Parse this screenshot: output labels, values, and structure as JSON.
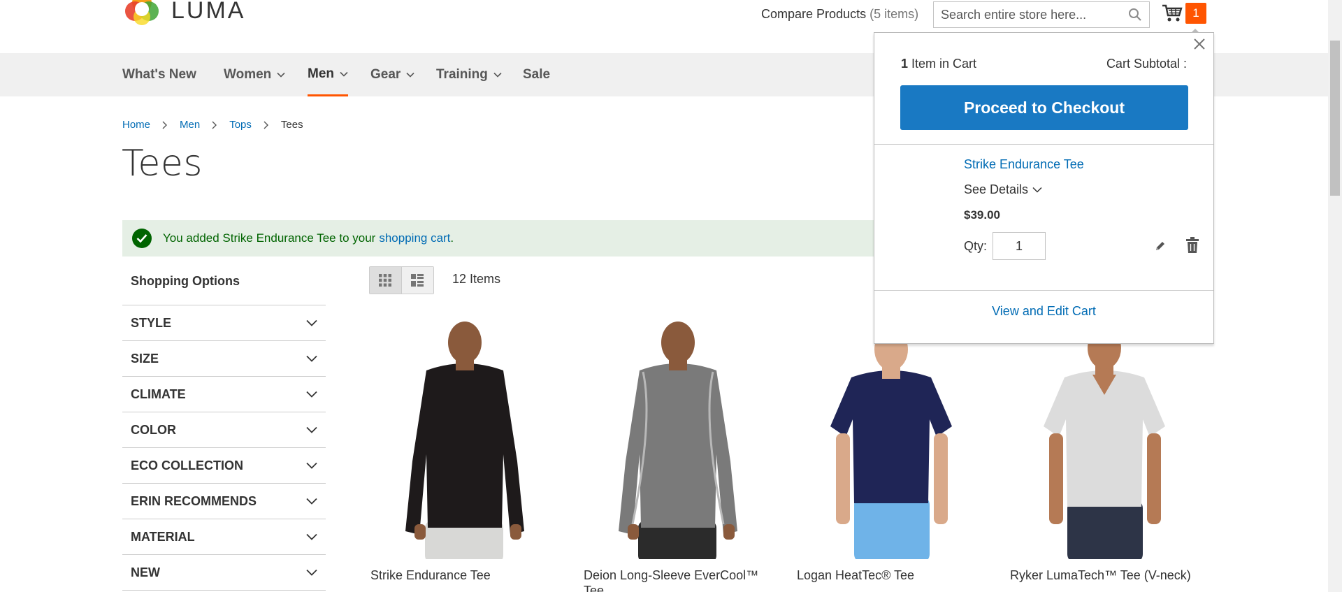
{
  "header": {
    "logo_text": "LUMA",
    "compare_label": "Compare Products",
    "compare_count": "(5 items)",
    "search_placeholder": "Search entire store here...",
    "cart_count": "1"
  },
  "nav": {
    "items": [
      {
        "label": "What's New",
        "dropdown": false
      },
      {
        "label": "Women",
        "dropdown": true
      },
      {
        "label": "Men",
        "dropdown": true,
        "active": true
      },
      {
        "label": "Gear",
        "dropdown": true
      },
      {
        "label": "Training",
        "dropdown": true
      },
      {
        "label": "Sale",
        "dropdown": false
      }
    ]
  },
  "breadcrumb": {
    "items": [
      "Home",
      "Men",
      "Tops"
    ],
    "current": "Tees"
  },
  "page_title": "Tees",
  "message": {
    "prefix": "You added Strike Endurance Tee to your",
    "link": "shopping cart",
    "suffix": "."
  },
  "sidebar": {
    "title": "Shopping Options",
    "filters": [
      "STYLE",
      "SIZE",
      "CLIMATE",
      "COLOR",
      "ECO COLLECTION",
      "ERIN RECOMMENDS",
      "MATERIAL",
      "NEW"
    ]
  },
  "toolbar": {
    "item_count": "12 Items",
    "mode": "grid"
  },
  "products": [
    {
      "name": "Strike Endurance Tee",
      "shirt_color": "#1e1a1b",
      "pants_color": "#d8d8d6"
    },
    {
      "name": "Deion Long-Sleeve EverCool™ Tee",
      "shirt_color": "#7a7a7a",
      "pants_color": "#2b2b2b"
    },
    {
      "name": "Logan HeatTec® Tee",
      "shirt_color": "#1f2556",
      "pants_color": "#6fb3e8"
    },
    {
      "name": "Ryker LumaTech™ Tee (V-neck)",
      "shirt_color": "#dcdcdc",
      "pants_color": "#2d3447"
    }
  ],
  "minicart": {
    "count": "1",
    "count_label": "Item in Cart",
    "subtotal_label": "Cart Subtotal :",
    "checkout_label": "Proceed to Checkout",
    "item": {
      "name": "Strike Endurance Tee",
      "details_label": "See Details",
      "price": "$39.00",
      "qty_label": "Qty:",
      "qty": "1"
    },
    "view_edit_label": "View and Edit Cart"
  },
  "colors": {
    "accent": "#ff5501",
    "link": "#006bb4",
    "button": "#1979c3",
    "success_bg": "#e5efe5",
    "success_text": "#006400"
  }
}
